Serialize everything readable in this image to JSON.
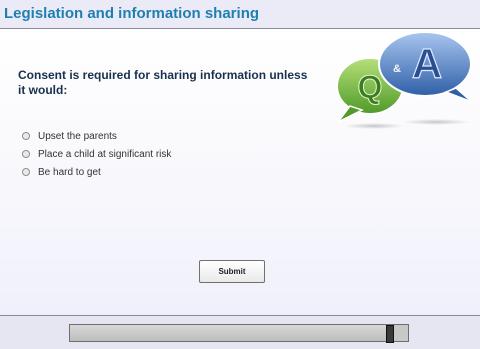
{
  "header": {
    "title": "Legislation and information sharing"
  },
  "question": {
    "text": "Consent is required for sharing information unless it would:"
  },
  "options": [
    {
      "label": "Upset the parents"
    },
    {
      "label": "Place a child at significant risk"
    },
    {
      "label": "Be hard to get"
    }
  ],
  "graphic": {
    "letter1": "Q",
    "amp": "&",
    "letter2": "A"
  },
  "submit": {
    "label": "Submit"
  },
  "progress": {
    "value": 0.96
  },
  "colors": {
    "title": "#1f7fb0",
    "question": "#17314f",
    "bubble_green": "#7cc242",
    "bubble_blue": "#3a6fb8"
  }
}
